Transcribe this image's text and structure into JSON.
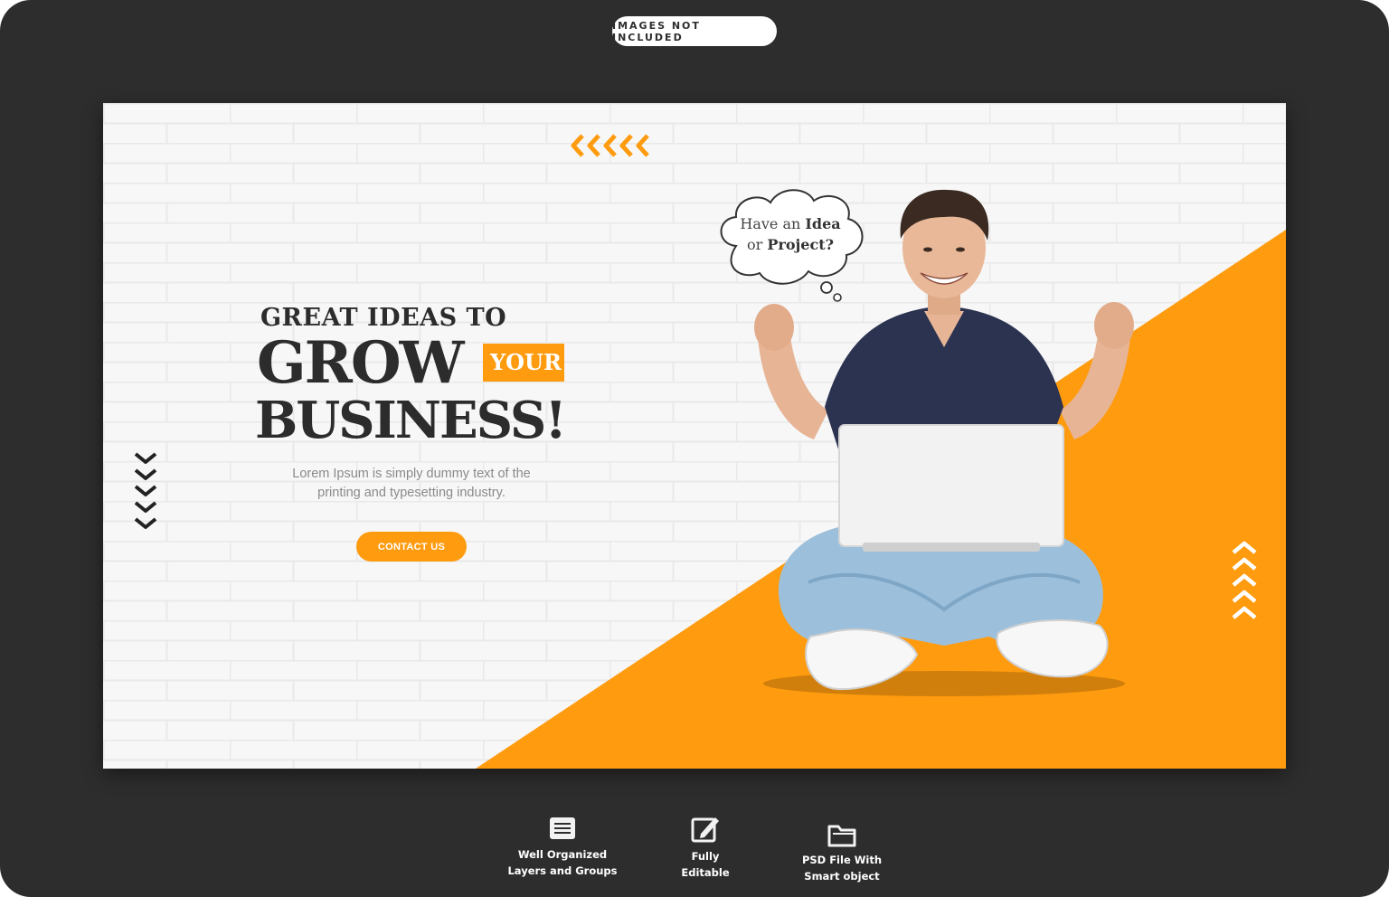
{
  "badge": {
    "label": "IMAGES NOT INCLUDED"
  },
  "banner": {
    "headline_top": "GREAT IDEAS TO",
    "headline_grow": "GROW",
    "headline_your": "YOUR",
    "headline_business": "BUSINESS!",
    "body_line1": "Lorem Ipsum is simply dummy text of the",
    "body_line2": "printing and typesetting industry.",
    "cta_label": "CONTACT US",
    "bubble_line1_a": "Have an ",
    "bubble_line1_b": "Idea",
    "bubble_line2_a": "or ",
    "bubble_line2_b": "Project?"
  },
  "features": [
    {
      "line1": "Well Organized",
      "line2": "Layers and Groups",
      "icon": "layers-icon"
    },
    {
      "line1": "Fully",
      "line2": "Editable",
      "icon": "edit-icon"
    },
    {
      "line1": "PSD File With",
      "line2": "Smart object",
      "icon": "folder-icon"
    }
  ],
  "colors": {
    "accent": "#ff9b0f",
    "frame": "#2d2d2d",
    "text_dark": "#2c2c2c"
  }
}
